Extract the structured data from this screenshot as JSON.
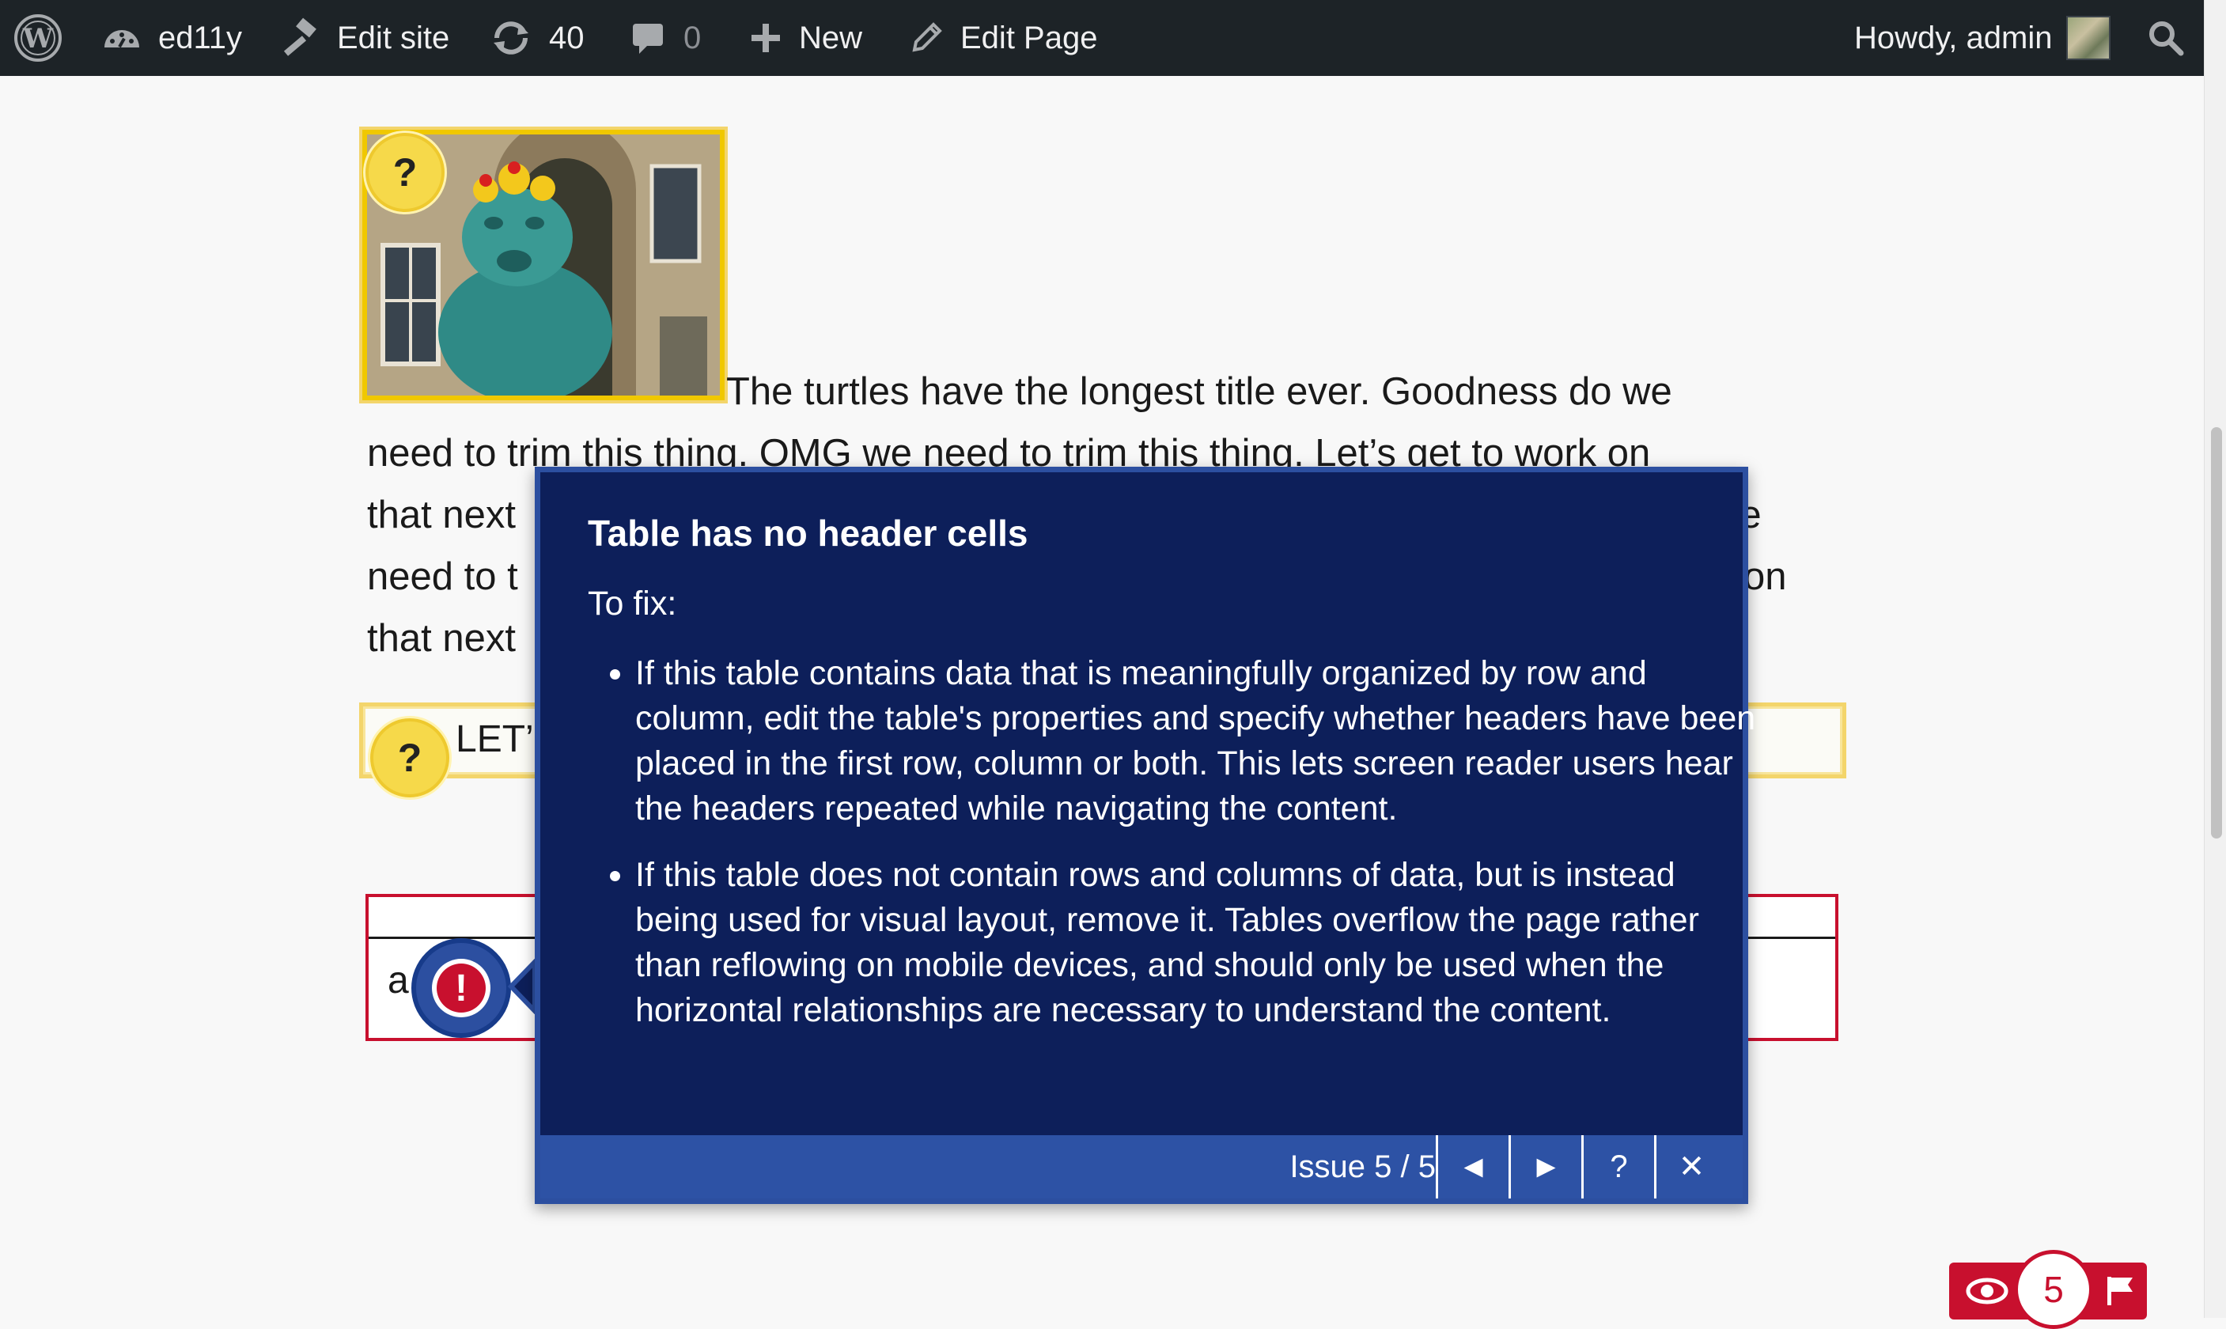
{
  "adminbar": {
    "site_name": "ed11y",
    "edit_site": "Edit site",
    "updates_count": "40",
    "comments_count": "0",
    "new_label": "New",
    "edit_page": "Edit Page",
    "howdy": "Howdy, admin"
  },
  "content": {
    "paragraph_line1": "The turtles have the longest title ever. Goodness do we",
    "paragraph_line2": "need to trim this thing. OMG we need to trim this thing. Let’s get to work on",
    "paragraph_line3_start": "that next",
    "paragraph_line3_end": "we",
    "paragraph_line4_start": "need to t",
    "paragraph_line4_end": "on",
    "paragraph_line5_start": "that next",
    "heading_visible": "LET’",
    "table_cell": "a",
    "question_mark": "?",
    "error_mark": "!"
  },
  "tooltip": {
    "title": "Table has no header cells",
    "to_fix": "To fix:",
    "items": [
      "If this table contains data that is meaningfully organized by row and column, edit the table's properties and specify whether headers have been placed in the first row, column or both. This lets screen reader users hear the headers repeated while navigating the content.",
      "If this table does not contain rows and columns of data, but is instead being used for visual layout, remove it. Tables overflow the page rather than reflowing on mobile devices, and should only be used when the horizontal relationships are necessary to understand the content."
    ],
    "issue_counter": "Issue 5 / 5",
    "prev_label": "◄",
    "next_label": "►",
    "help_label": "?",
    "close_label": "✕"
  },
  "checker_panel": {
    "issue_count": "5"
  },
  "colors": {
    "adminbar_bg": "#1d2327",
    "tooltip_bg": "#0d1f5a",
    "tooltip_footer": "#2d52a5",
    "warning_yellow": "#f6d94a",
    "error_red": "#c8102e"
  },
  "icons": {
    "wp_logo": "wordpress-logo-icon",
    "dashboard": "dashboard-icon",
    "edit_site": "hammer-icon",
    "updates": "refresh-icon",
    "comments": "comment-icon",
    "new": "plus-icon",
    "edit_page": "pencil-icon",
    "search": "search-icon",
    "visibility": "eye-icon",
    "flag": "flag-icon"
  }
}
